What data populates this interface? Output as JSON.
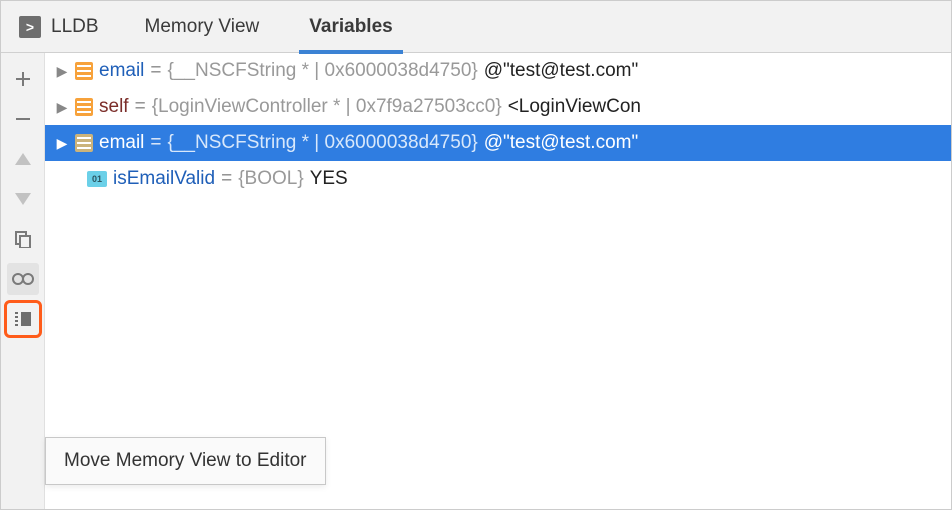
{
  "tabs": {
    "lldb": "LLDB",
    "memory": "Memory View",
    "variables": "Variables"
  },
  "rows": [
    {
      "name": "email",
      "type": "{__NSCFString * | 0x6000038d4750}",
      "value": "@\"test@test.com\""
    },
    {
      "name": "self",
      "type": "{LoginViewController * | 0x7f9a27503cc0}",
      "value": "<LoginViewCon"
    },
    {
      "name": "email",
      "type": "{__NSCFString * | 0x6000038d4750}",
      "value": "@\"test@test.com\""
    },
    {
      "name": "isEmailValid",
      "type": "{BOOL}",
      "value": "YES"
    }
  ],
  "eq": "=",
  "boolicon": "01",
  "tooltip": "Move Memory View to Editor"
}
